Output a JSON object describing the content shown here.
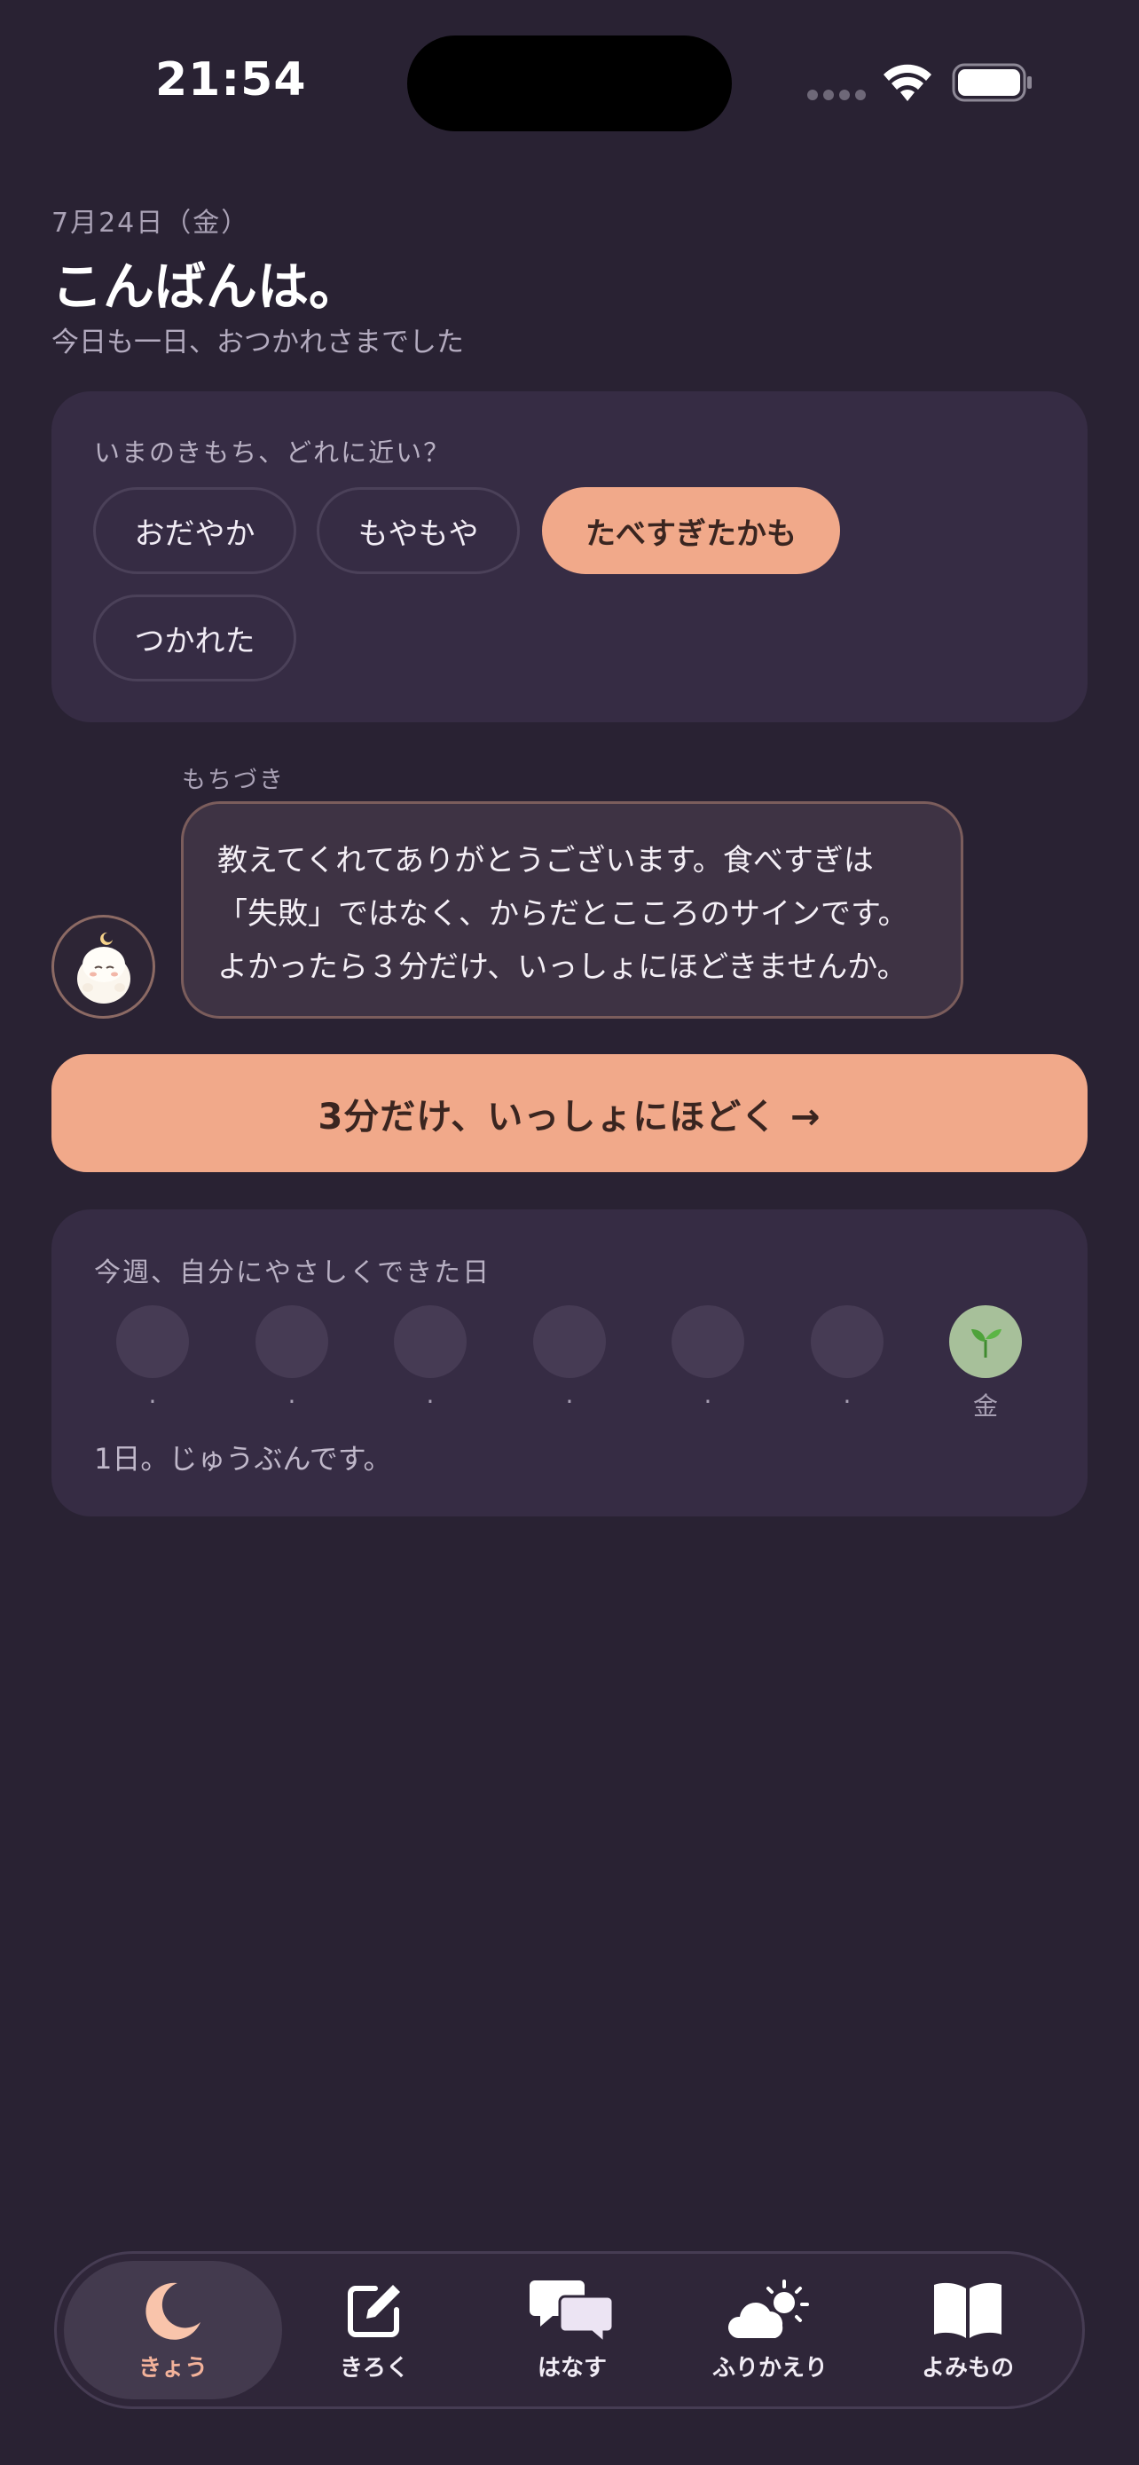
{
  "status_bar": {
    "time": "21:54"
  },
  "header": {
    "date": "7月24日（金）",
    "greeting": "こんばんは。",
    "subtitle": "今日も一日、おつかれさまでした"
  },
  "mood": {
    "question": "いまのきもち、どれに近い？",
    "options": [
      "おだやか",
      "もやもや",
      "たべすぎたかも",
      "つかれた"
    ],
    "selected": "たべすぎたかも"
  },
  "chat": {
    "speaker": "もちづき",
    "lines": [
      "教えてくれてありがとうございます。食べすぎは",
      "「失敗」ではなく、からだとこころのサインです。",
      "よかったら３分だけ、いっしょにほどきませんか。"
    ]
  },
  "cta": {
    "label": "3分だけ、いっしょにほどく →"
  },
  "week": {
    "title": "今週、自分にやさしくできた日",
    "days": [
      {
        "label": "·",
        "done": false
      },
      {
        "label": "·",
        "done": false
      },
      {
        "label": "·",
        "done": false
      },
      {
        "label": "·",
        "done": false
      },
      {
        "label": "·",
        "done": false
      },
      {
        "label": "·",
        "done": false
      },
      {
        "label": "金",
        "done": true
      }
    ],
    "summary": "1日。じゅうぶんです。"
  },
  "tabs": [
    {
      "label": "きょう",
      "icon": "moon-icon",
      "active": true
    },
    {
      "label": "きろく",
      "icon": "edit-icon",
      "active": false
    },
    {
      "label": "はなす",
      "icon": "chat-bubbles-icon",
      "active": false
    },
    {
      "label": "ふりかえり",
      "icon": "partly-sunny-icon",
      "active": false
    },
    {
      "label": "よみもの",
      "icon": "book-icon",
      "active": false
    }
  ],
  "colors": {
    "background": "#292233",
    "card": "#362c44",
    "accent": "#f1a98a",
    "done_day": "#a7c09a"
  }
}
